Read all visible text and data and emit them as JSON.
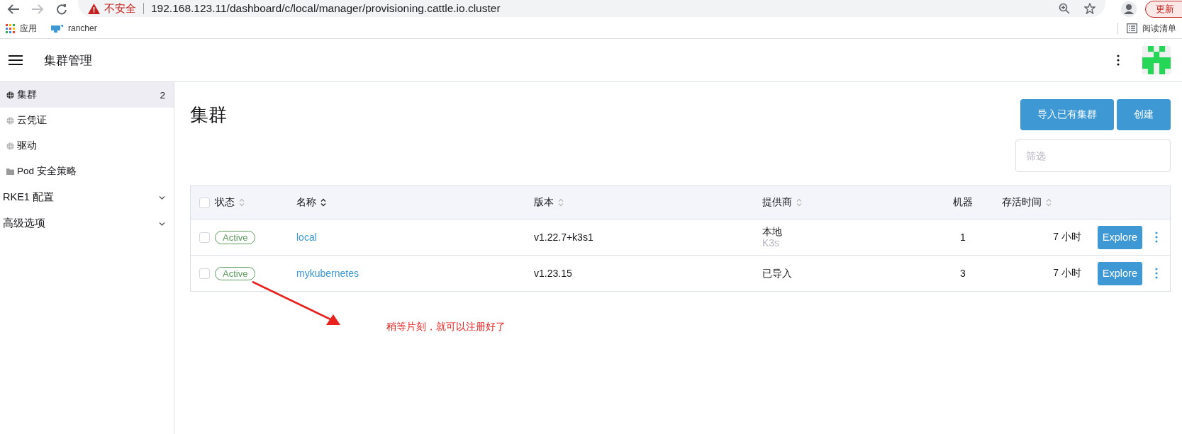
{
  "browser": {
    "security_label": "不安全",
    "url": "192.168.123.11/dashboard/c/local/manager/provisioning.cattle.io.cluster",
    "update_label": "更新"
  },
  "bookmarks": [
    {
      "kind": "apps",
      "label": "应用"
    },
    {
      "kind": "rancher",
      "label": "rancher"
    }
  ],
  "reading_list": "阅读清单",
  "header": {
    "title": "集群管理"
  },
  "sidebar": {
    "items": [
      {
        "kind": "globe",
        "label": "集群",
        "count": "2",
        "selected": true
      },
      {
        "kind": "globe",
        "label": "云凭证",
        "selected": false
      },
      {
        "kind": "globe",
        "label": "驱动",
        "selected": false
      },
      {
        "kind": "folder",
        "label": "Pod 安全策略",
        "selected": false
      }
    ],
    "groups": [
      {
        "label": "RKE1 配置",
        "expanded": false
      },
      {
        "label": "高级选项",
        "expanded": false
      }
    ]
  },
  "page": {
    "title": "集群",
    "buttons": [
      "导入已有集群",
      "创建"
    ],
    "filter": {
      "placeholder": "筛选"
    }
  },
  "table": {
    "all_checked": false,
    "columns": [
      {
        "label": "状态",
        "sorted": false
      },
      {
        "label": "名称",
        "sorted": true
      },
      {
        "label": "版本",
        "sorted": false
      },
      {
        "label": "提供商",
        "sorted": false
      },
      {
        "label": "机器"
      },
      {
        "label": "存活时间",
        "sorted": false
      }
    ],
    "rows": [
      {
        "checked": false,
        "state": "Active",
        "name": "local",
        "version": "v1.22.7+k3s1",
        "provider": "本地",
        "provider_sub": "K3s",
        "machines": "1",
        "age": "7 小时",
        "action": "Explore"
      },
      {
        "checked": false,
        "state": "Active",
        "name": "mykubernetes",
        "version": "v1.23.15",
        "provider": "已导入",
        "machines": "3",
        "age": "7 小时",
        "action": "Explore"
      }
    ]
  },
  "annotation": {
    "text": "稍等片刻，就可以注册好了"
  }
}
